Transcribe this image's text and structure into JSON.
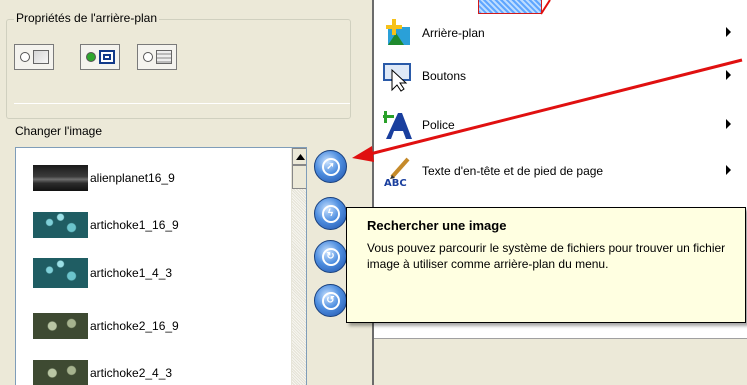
{
  "background_properties": {
    "group_title": "Propriétés de l'arrière-plan",
    "mode_buttons": [
      {
        "name": "none",
        "selected": false
      },
      {
        "name": "image",
        "selected": true
      },
      {
        "name": "pattern",
        "selected": false
      }
    ],
    "change_image_label": "Changer l'image"
  },
  "image_list": {
    "items": [
      {
        "label": "alienplanet16_9",
        "thumb": "planet"
      },
      {
        "label": "artichoke1_16_9",
        "thumb": "artichoke"
      },
      {
        "label": "artichoke1_4_3",
        "thumb": "artichoke"
      },
      {
        "label": "artichoke2_16_9",
        "thumb": "artichoke2"
      },
      {
        "label": "artichoke2_4_3",
        "thumb": "artichoke2"
      }
    ]
  },
  "side_buttons": [
    {
      "name": "browse-image",
      "icon": "browse-icon"
    },
    {
      "name": "refresh-image",
      "icon": "lightning-icon"
    },
    {
      "name": "rotate-image",
      "icon": "rotate-icon"
    },
    {
      "name": "reset-image",
      "icon": "reset-icon"
    }
  ],
  "menu": {
    "items": [
      {
        "label": "Arrière-plan",
        "icon": "background-icon",
        "submenu": true
      },
      {
        "label": "Boutons",
        "icon": "buttons-icon",
        "submenu": true
      },
      {
        "label": "Police",
        "icon": "font-icon",
        "submenu": true
      },
      {
        "label": "Texte d'en-tête et de pied de page",
        "icon": "header-footer-icon",
        "submenu": true
      }
    ]
  },
  "tooltip": {
    "title": "Rechercher une image",
    "body": "Vous pouvez parcourir le système de fichiers pour trouver un fichier image à utiliser comme arrière-plan du menu."
  },
  "colors": {
    "annotation": "#e01010",
    "tooltip_bg": "#ffffe1",
    "panel_bg": "#ece9d8",
    "accent_blue": "#4f8fe0"
  }
}
